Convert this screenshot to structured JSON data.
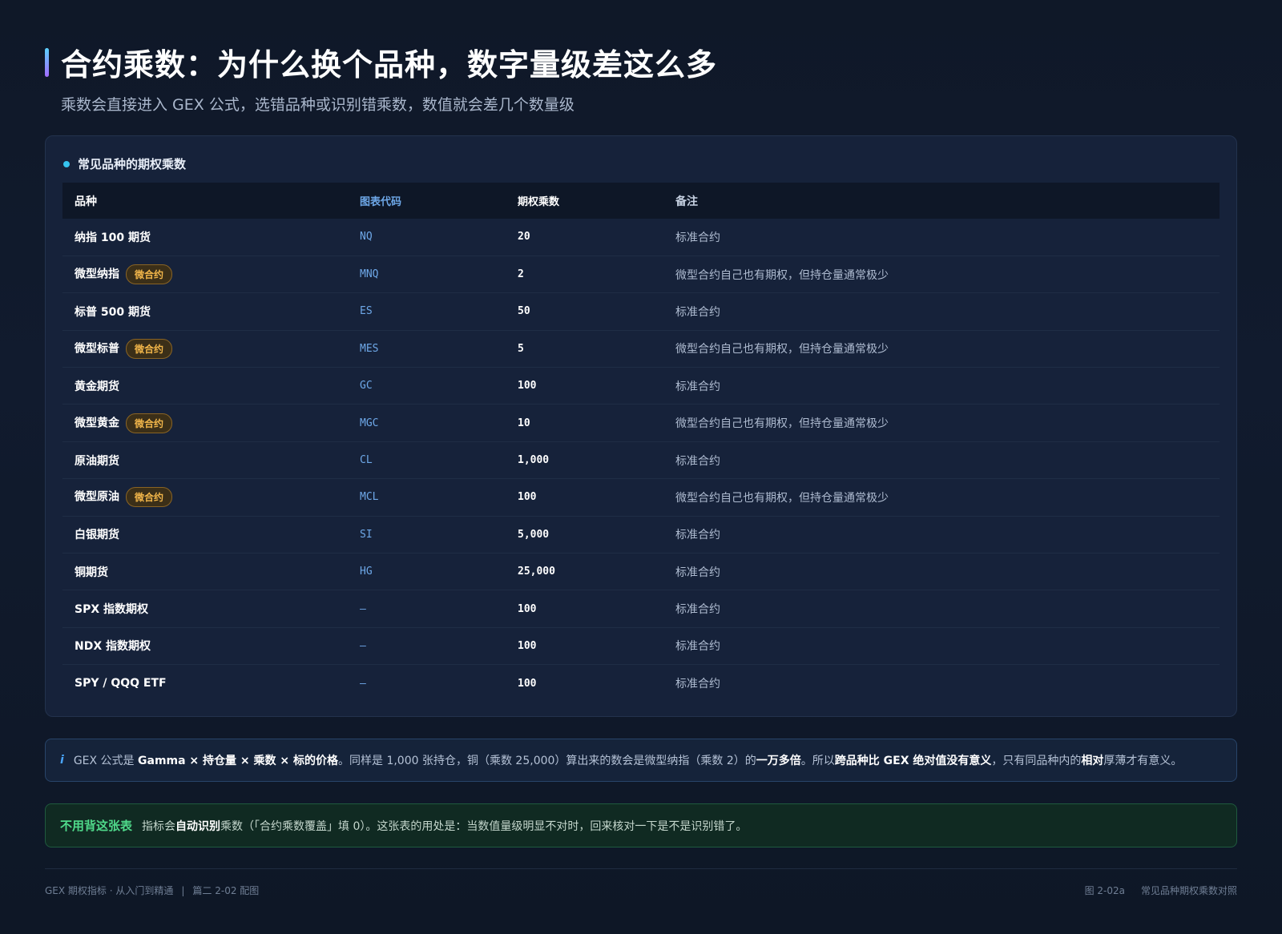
{
  "header": {
    "title": "合约乘数：为什么换个品种，数字量级差这么多",
    "subtitle": "乘数会直接进入 GEX 公式，选错品种或识别错乘数，数值就会差几个数量级"
  },
  "card": {
    "title": "常见品种的期权乘数",
    "columns": [
      "品种",
      "图表代码",
      "期权乘数",
      "备注"
    ],
    "rows": [
      {
        "name": "纳指 100 期货",
        "badge": "",
        "code": "NQ",
        "mult": "20",
        "note": "标准合约"
      },
      {
        "name": "微型纳指",
        "badge": "微合约",
        "code": "MNQ",
        "mult": "2",
        "note": "微型合约自己也有期权，但持仓量通常极少"
      },
      {
        "name": "标普 500 期货",
        "badge": "",
        "code": "ES",
        "mult": "50",
        "note": "标准合约"
      },
      {
        "name": "微型标普",
        "badge": "微合约",
        "code": "MES",
        "mult": "5",
        "note": "微型合约自己也有期权，但持仓量通常极少"
      },
      {
        "name": "黄金期货",
        "badge": "",
        "code": "GC",
        "mult": "100",
        "note": "标准合约"
      },
      {
        "name": "微型黄金",
        "badge": "微合约",
        "code": "MGC",
        "mult": "10",
        "note": "微型合约自己也有期权，但持仓量通常极少"
      },
      {
        "name": "原油期货",
        "badge": "",
        "code": "CL",
        "mult": "1,000",
        "note": "标准合约"
      },
      {
        "name": "微型原油",
        "badge": "微合约",
        "code": "MCL",
        "mult": "100",
        "note": "微型合约自己也有期权，但持仓量通常极少"
      },
      {
        "name": "白银期货",
        "badge": "",
        "code": "SI",
        "mult": "5,000",
        "note": "标准合约"
      },
      {
        "name": "铜期货",
        "badge": "",
        "code": "HG",
        "mult": "25,000",
        "note": "标准合约"
      },
      {
        "name": "SPX 指数期权",
        "badge": "",
        "code": "—",
        "mult": "100",
        "note": "标准合约"
      },
      {
        "name": "NDX 指数期权",
        "badge": "",
        "code": "—",
        "mult": "100",
        "note": "标准合约"
      },
      {
        "name": "SPY / QQQ ETF",
        "badge": "",
        "code": "—",
        "mult": "100",
        "note": "标准合约"
      }
    ]
  },
  "info": {
    "icon": "i",
    "t1": "GEX 公式是 ",
    "b1": "Gamma × 持仓量 × 乘数 × 标的价格",
    "t2": "。同样是 1,000 张持仓，铜（乘数 25,000）算出来的数会是微型纳指（乘数 2）的",
    "b2": "一万多倍",
    "t3": "。所以",
    "b3": "跨品种比 GEX 绝对值没有意义",
    "t4": "，只有同品种内的",
    "b4": "相对",
    "t5": "厚薄才有意义。"
  },
  "tip": {
    "label": "不用背这张表",
    "t1": "指标会",
    "b1": "自动识别",
    "t2": "乘数（「合约乘数覆盖」填 0）。这张表的用处是：当数值量级明显不对时，回来核对一下是不是识别错了。"
  },
  "footer": {
    "left_a": "GEX 期权指标 · 从入门到精通",
    "left_sep": "|",
    "left_b": "篇二 2-02 配图",
    "right_a": "图 2-02a",
    "right_b": "常见品种期权乘数对照"
  },
  "colors": {
    "accent": "#35c4f0",
    "badge": "#f2b64a",
    "tip_green": "#4fd98a",
    "code_blue": "#6ea8e8"
  }
}
